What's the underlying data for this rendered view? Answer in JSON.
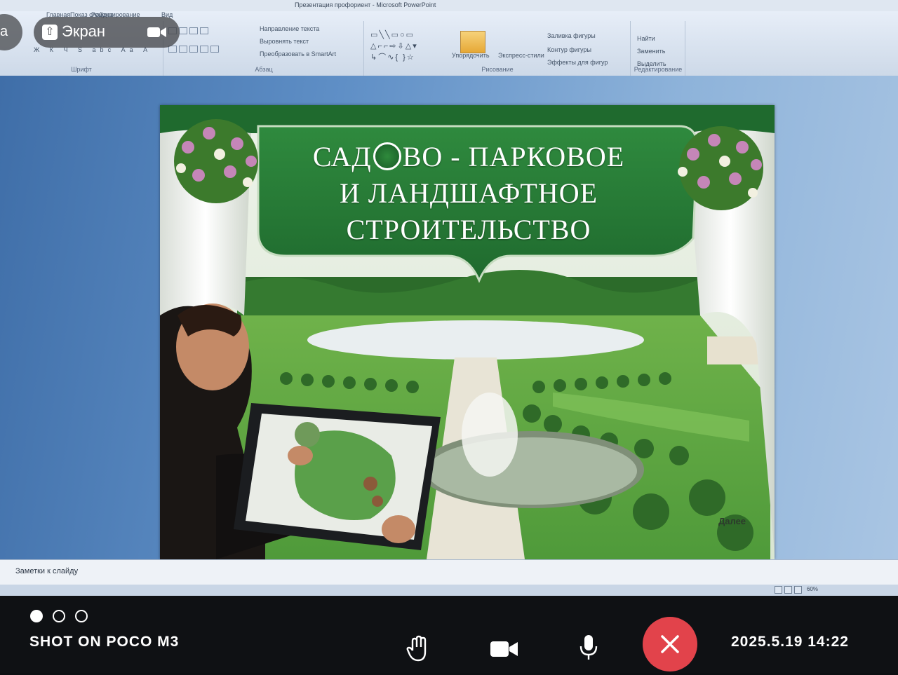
{
  "window": {
    "title": "Презентация профориент - Microsoft PowerPoint",
    "tabs": [
      "Главная",
      "Показ слайдов",
      "Рецензирование",
      "Вид"
    ]
  },
  "ribbon": {
    "groups": [
      "Шрифт",
      "Абзац",
      "Рисование",
      "Редактирование"
    ],
    "paragraph_buttons": [
      "Направление текста",
      "Выровнять текст",
      "Преобразовать в SmartArt"
    ],
    "drawing_buttons": [
      "Упорядочить",
      "Экспресс-стили"
    ],
    "shape_format_buttons": [
      "Заливка фигуры",
      "Контур фигуры",
      "Эффекты для фигур"
    ],
    "editing_buttons": [
      "Найти",
      "Заменить",
      "Выделить"
    ]
  },
  "slide": {
    "title_line1_a": "САД",
    "title_line1_b": "ВО - ПАРКОВОЕ",
    "title_line2": "И ЛАНДШАФТНОЕ",
    "title_line3": "СТРОИТЕЛЬСТВО",
    "next_label": "Далее"
  },
  "notes": {
    "label": "Заметки к слайду"
  },
  "status": {
    "zoom": "60%"
  },
  "call_overlay": {
    "screen_label": "Экран",
    "left_fragment": "a"
  },
  "camera_watermark": {
    "shot_on": "SHOT ON POCO M3",
    "timestamp": "2025.5.19 14:22"
  },
  "colors": {
    "slide_green": "#2a6f3a",
    "end_call_red": "#e2434b",
    "workspace_blue": "#5f8fc6"
  },
  "icons": [
    "screen-share-icon",
    "camera-icon",
    "raise-hand-icon",
    "video-icon",
    "microphone-icon",
    "close-icon"
  ]
}
